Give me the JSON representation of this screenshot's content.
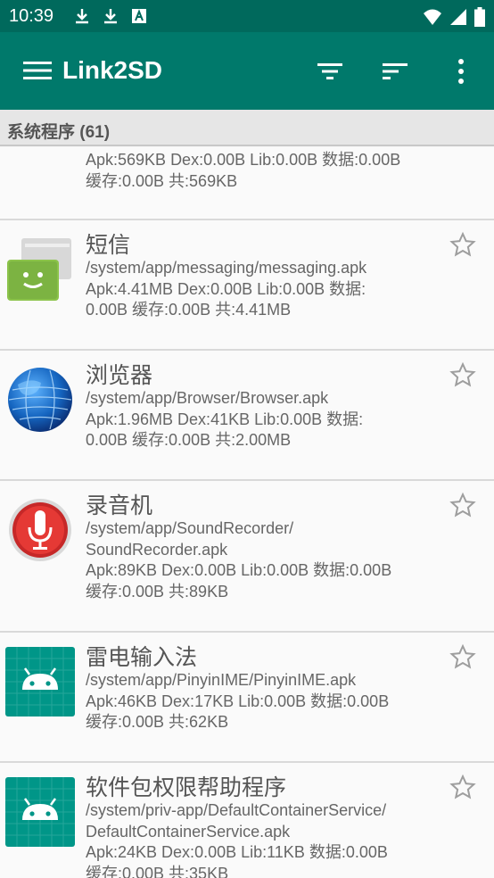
{
  "status": {
    "time": "10:39"
  },
  "appbar": {
    "title": "Link2SD"
  },
  "section": {
    "label": "系统程序 (61)"
  },
  "partial_item": {
    "line1": "Apk:569KB  Dex:0.00B  Lib:0.00B  数据:0.00B",
    "line2": "缓存:0.00B  共:569KB"
  },
  "apps": [
    {
      "name": "短信",
      "path": "/system/app/messaging/messaging.apk",
      "line1": "Apk:4.41MB  Dex:0.00B  Lib:0.00B  数据:",
      "line2": "0.00B  缓存:0.00B  共:4.41MB",
      "icon": "messaging-icon"
    },
    {
      "name": "浏览器",
      "path": "/system/app/Browser/Browser.apk",
      "line1": "Apk:1.96MB  Dex:41KB  Lib:0.00B  数据:",
      "line2": "0.00B  缓存:0.00B  共:2.00MB",
      "icon": "globe-icon"
    },
    {
      "name": "录音机",
      "path1": "/system/app/SoundRecorder/",
      "path2": "SoundRecorder.apk",
      "line1": "Apk:89KB  Dex:0.00B  Lib:0.00B  数据:0.00B",
      "line2": "缓存:0.00B  共:89KB",
      "icon": "microphone-icon"
    },
    {
      "name": "雷电输入法",
      "path": "/system/app/PinyinIME/PinyinIME.apk",
      "line1": "Apk:46KB  Dex:17KB  Lib:0.00B  数据:0.00B",
      "line2": "缓存:0.00B  共:62KB",
      "icon": "android-icon"
    },
    {
      "name": "软件包权限帮助程序",
      "path1": "/system/priv-app/DefaultContainerService/",
      "path2": "DefaultContainerService.apk",
      "line1": "Apk:24KB  Dex:0.00B  Lib:11KB  数据:0.00B",
      "line2": "缓存:0.00B  共:35KB",
      "icon": "android-icon"
    }
  ]
}
